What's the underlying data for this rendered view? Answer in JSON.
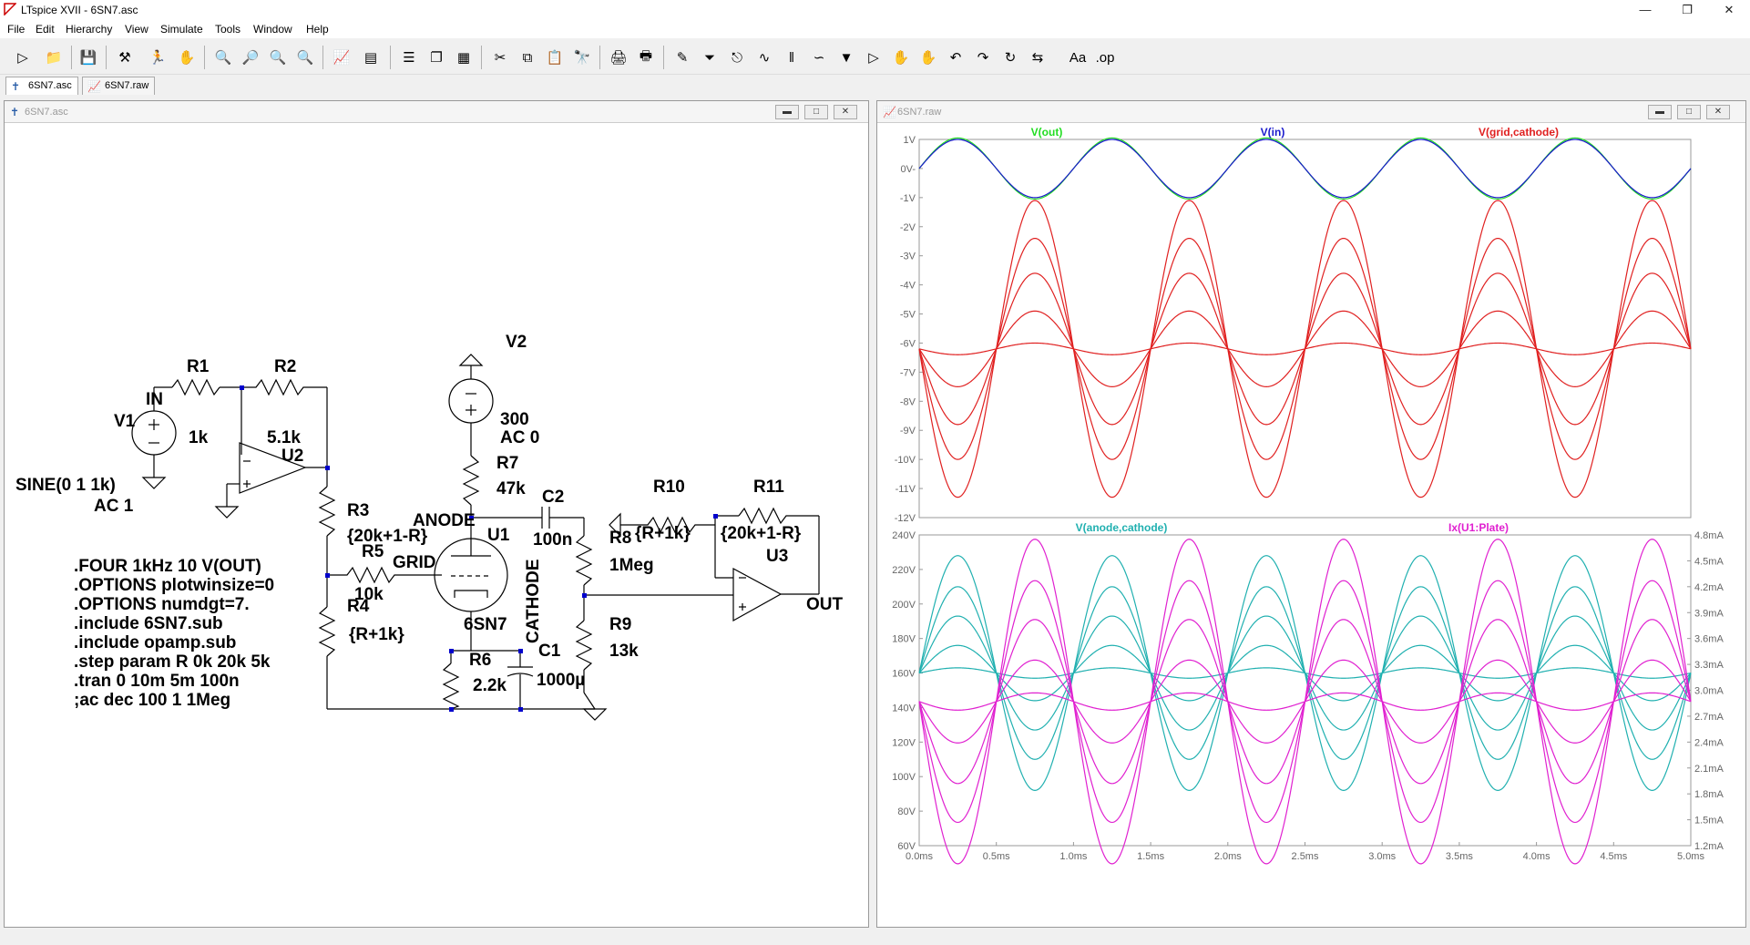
{
  "window": {
    "title": "LTspice XVII - 6SN7.asc"
  },
  "menu": [
    "File",
    "Edit",
    "Hierarchy",
    "View",
    "Simulate",
    "Tools",
    "Window",
    "Help"
  ],
  "tabs": [
    {
      "label": "6SN7.asc",
      "icon": "schematic-icon"
    },
    {
      "label": "6SN7.raw",
      "icon": "waveform-icon"
    }
  ],
  "schematic_window": {
    "title": "6SN7.asc"
  },
  "plot_window": {
    "title": "6SN7.raw"
  },
  "schematic": {
    "labels": {
      "in": "IN",
      "out": "OUT",
      "grid": "GRID",
      "anode": "ANODE",
      "cathode": "CATHODE",
      "v1": "V1",
      "v1_val": "SINE(0 1 1k)",
      "v1_ac": "AC 1",
      "v2": "V2",
      "v2_val": "300",
      "v2_ac": "AC 0",
      "r1": "R1",
      "r1_val": "1k",
      "r2": "R2",
      "r2_val": "5.1k",
      "r3": "R3",
      "r3_val": "{20k+1-R}",
      "r4": "R4",
      "r4_val": "{R+1k}",
      "r5": "R5",
      "r5_val": "10k",
      "r6": "R6",
      "r6_val": "2.2k",
      "r7": "R7",
      "r7_val": "47k",
      "r8": "R8",
      "r8_val": "1Meg",
      "r9": "R9",
      "r9_val": "13k",
      "r10": "R10",
      "r10_val": "{R+1k}",
      "r11": "R11",
      "r11_val": "{20k+1-R}",
      "c1": "C1",
      "c1_val": "1000µ",
      "c2": "C2",
      "c2_val": "100n",
      "u1": "U1",
      "u1_model": "6SN7",
      "u2": "U2",
      "u3": "U3"
    },
    "directives": [
      ".FOUR 1kHz 10 V(OUT)",
      ".OPTIONS plotwinsize=0",
      ".OPTIONS numdgt=7.",
      ".include 6SN7.sub",
      ".include opamp.sub",
      ".step param R 0k 20k 5k",
      ".tran 0 10m 5m 100n",
      ";ac dec 100 1 1Meg"
    ]
  },
  "chart_data": [
    {
      "type": "line",
      "title": "",
      "xlim": [
        0,
        5
      ],
      "ylim": [
        -12,
        1
      ],
      "y_ticks": [
        "1V",
        "0V-",
        "-1V",
        "-2V",
        "-3V",
        "-4V",
        "-5V",
        "-6V",
        "-7V",
        "-8V",
        "-9V",
        "-10V",
        "-11V",
        "-12V"
      ],
      "legend": [
        "V(out)",
        "V(in)",
        "V(grid,cathode)"
      ],
      "series": [
        {
          "name": "V(out)",
          "color": "#22dd22",
          "offset": 0,
          "amplitude": 1.05,
          "freq_khz": 1,
          "phase": "sin"
        },
        {
          "name": "V(in)",
          "color": "#1a1acc",
          "offset": 0,
          "amplitude": 1.0,
          "freq_khz": 1,
          "phase": "sin"
        },
        {
          "name": "V(grid,cathode)",
          "color": "#e02020",
          "offset": -6.2,
          "amplitudes": [
            5.1,
            3.8,
            2.6,
            1.3,
            0.2
          ],
          "freq_khz": 1,
          "phase": "-sin"
        }
      ]
    },
    {
      "type": "line",
      "xlim": [
        0,
        5
      ],
      "ylim": [
        60,
        240
      ],
      "y2lim": [
        1.2,
        4.8
      ],
      "x_ticks": [
        "0.0ms",
        "0.5ms",
        "1.0ms",
        "1.5ms",
        "2.0ms",
        "2.5ms",
        "3.0ms",
        "3.5ms",
        "4.0ms",
        "4.5ms",
        "5.0ms"
      ],
      "y_ticks": [
        "240V",
        "220V",
        "200V",
        "180V",
        "160V",
        "140V",
        "120V",
        "100V",
        "80V",
        "60V"
      ],
      "y2_ticks": [
        "4.8mA",
        "4.5mA",
        "4.2mA",
        "3.9mA",
        "3.6mA",
        "3.3mA",
        "3.0mA",
        "2.7mA",
        "2.4mA",
        "2.1mA",
        "1.8mA",
        "1.5mA",
        "1.2mA"
      ],
      "legend": [
        "V(anode,cathode)",
        "Ix(U1:Plate)"
      ],
      "series": [
        {
          "name": "V(anode,cathode)",
          "color": "#20b0b0",
          "axis": "left",
          "offset": 160,
          "amplitudes": [
            68,
            50,
            33,
            16,
            3
          ],
          "freq_khz": 1,
          "phase": "sin"
        },
        {
          "name": "Ix(U1:Plate)",
          "color": "#e020d0",
          "axis": "right",
          "offset": 2.87,
          "amplitudes": [
            1.88,
            1.4,
            0.95,
            0.48,
            0.1
          ],
          "freq_khz": 1,
          "phase": "-sin"
        }
      ]
    }
  ]
}
